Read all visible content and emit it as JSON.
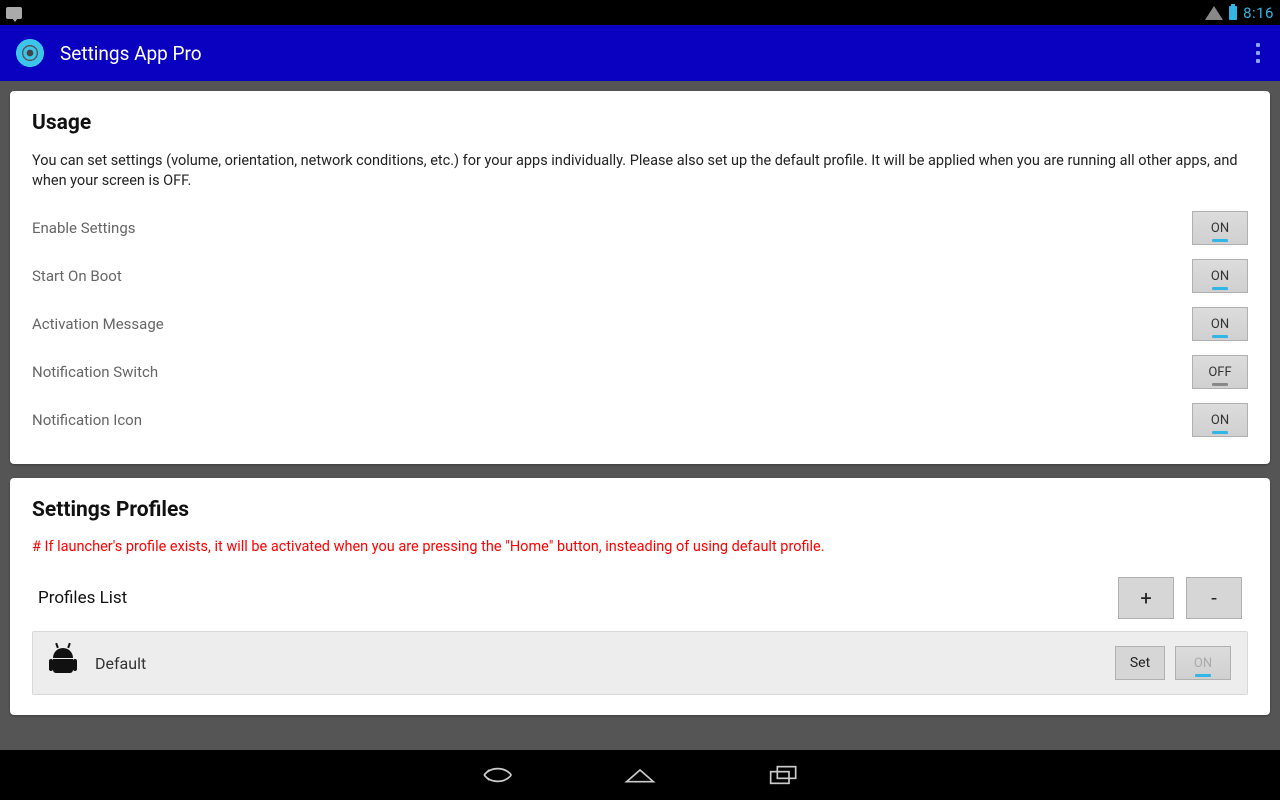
{
  "statusbar": {
    "time": "8:16"
  },
  "actionbar": {
    "title": "Settings App Pro"
  },
  "usage": {
    "heading": "Usage",
    "description": "You can set settings (volume, orientation, network conditions, etc.) for your apps individually. Please also set up the default profile. It will be applied when you are running all other apps, and when your screen is OFF.",
    "rows": [
      {
        "label": "Enable Settings",
        "value": "ON"
      },
      {
        "label": "Start On Boot",
        "value": "ON"
      },
      {
        "label": "Activation Message",
        "value": "ON"
      },
      {
        "label": "Notification Switch",
        "value": "OFF"
      },
      {
        "label": "Notification Icon",
        "value": "ON"
      }
    ]
  },
  "profiles": {
    "heading": "Settings Profiles",
    "note": "# If launcher's profile exists, it will be activated when you are pressing the \"Home\" button, insteading of using default profile.",
    "list_label": "Profiles List",
    "add_label": "+",
    "remove_label": "-",
    "items": [
      {
        "name": "Default",
        "set_label": "Set",
        "on_label": "ON"
      }
    ]
  }
}
